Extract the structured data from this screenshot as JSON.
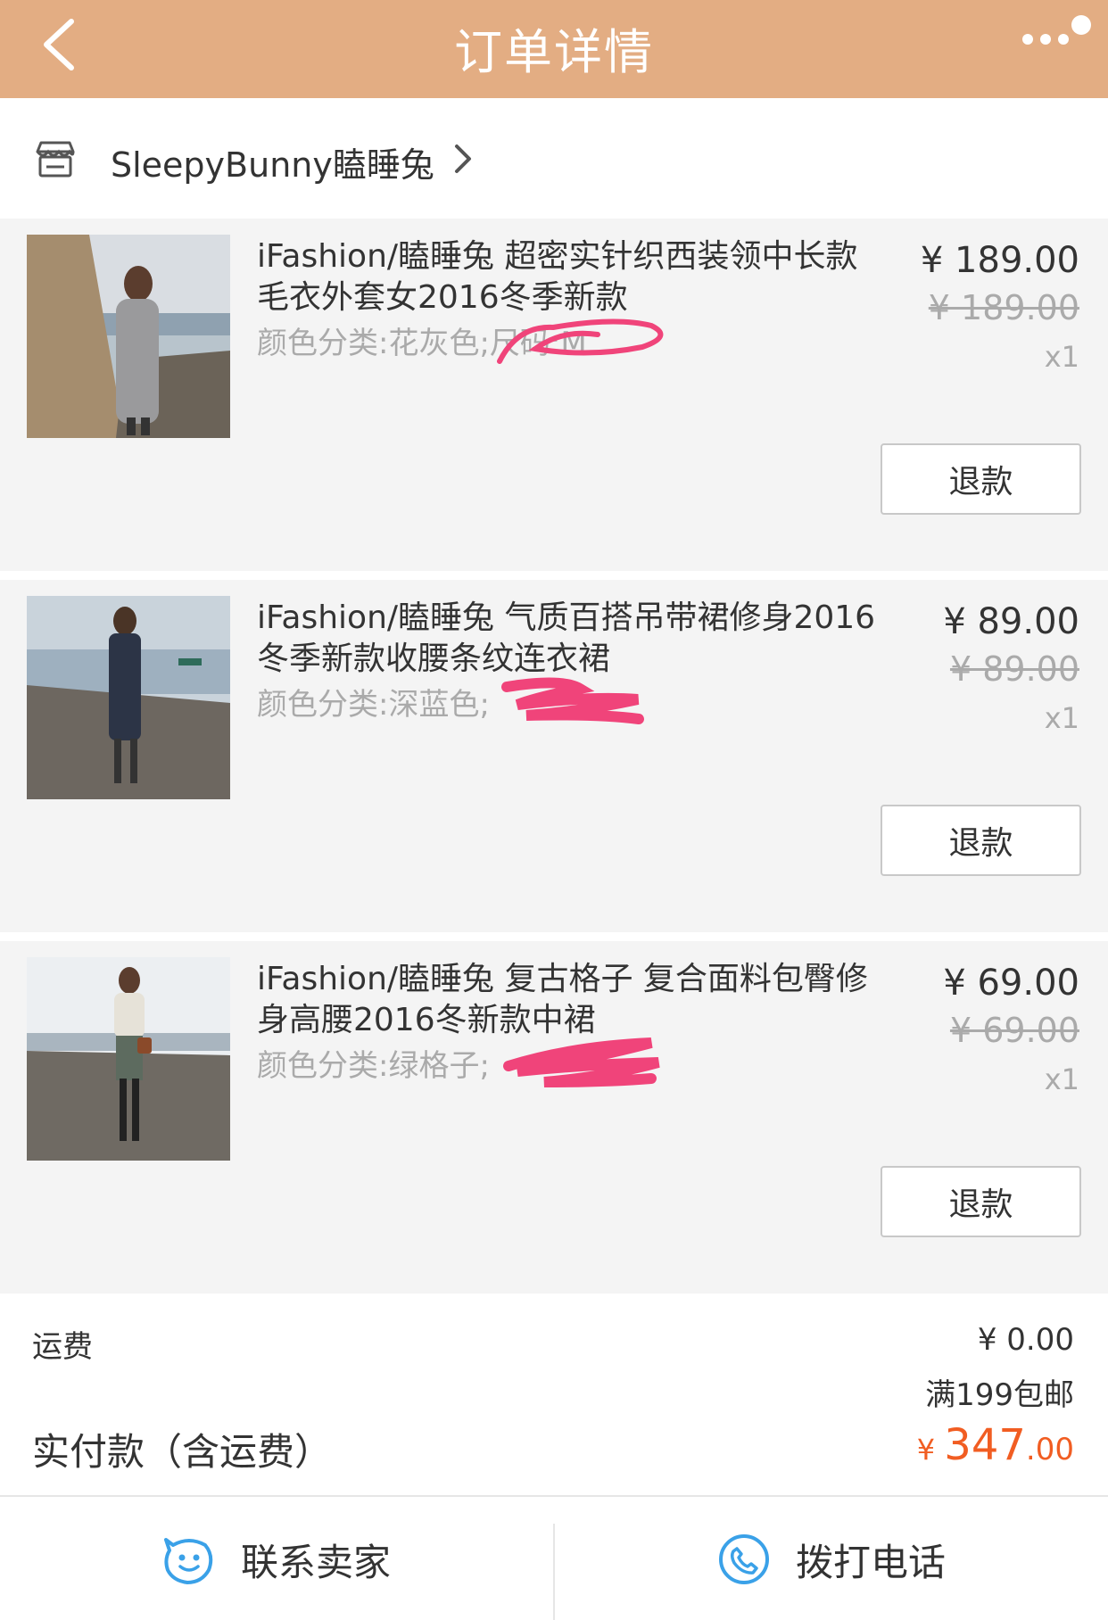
{
  "header": {
    "title": "订单详情",
    "back_icon": "chevron-left-icon",
    "more_icon": "more-dots-icon",
    "color": "#e3ad83"
  },
  "shop": {
    "icon": "store-icon",
    "name": "SleepyBunny瞌睡兔"
  },
  "items": [
    {
      "name": "iFashion/瞌睡兔 超密实针织西装领中长款毛衣外套女2016冬季新款",
      "variant": "颜色分类:花灰色;尺码:M",
      "price": "¥ 189.00",
      "original_price": "¥ 189.00",
      "quantity": "x1",
      "refund_label": "退款"
    },
    {
      "name": "iFashion/瞌睡兔 气质百搭吊带裙修身2016冬季新款收腰条纹连衣裙",
      "variant": "颜色分类:深蓝色;",
      "price": "¥ 89.00",
      "original_price": "¥ 89.00",
      "quantity": "x1",
      "refund_label": "退款"
    },
    {
      "name": "iFashion/瞌睡兔 复古格子 复合面料包臀修身高腰2016冬新款中裙",
      "variant": "颜色分类:绿格子;",
      "price": "¥ 69.00",
      "original_price": "¥ 69.00",
      "quantity": "x1",
      "refund_label": "退款"
    }
  ],
  "summary": {
    "shipping_label": "运费",
    "shipping_value": "¥ 0.00",
    "shipping_note": "满199包邮",
    "total_label": "实付款（含运费）",
    "total_currency": "¥ ",
    "total_int": "347",
    "total_dec": ".00",
    "total_color": "#f15d22"
  },
  "bottom_bar": {
    "contact_label": "联系卖家",
    "contact_icon": "chat-face-icon",
    "call_label": "拨打电话",
    "call_icon": "phone-icon",
    "icon_color": "#3aa1e8"
  }
}
